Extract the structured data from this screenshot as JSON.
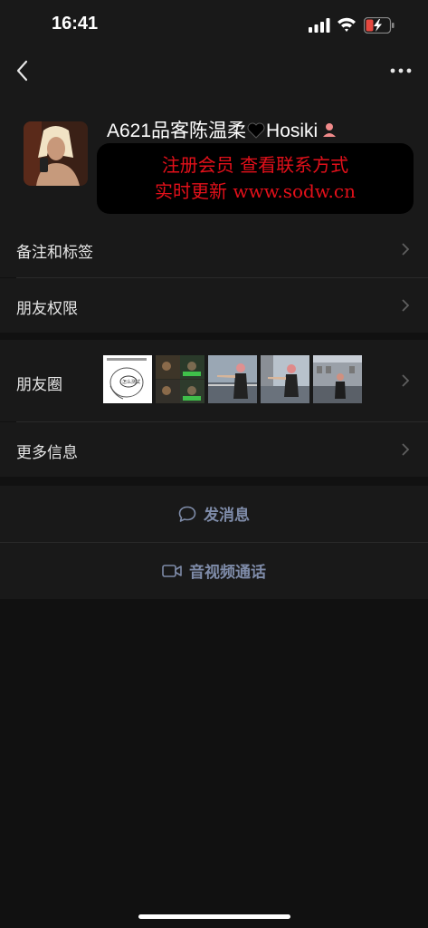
{
  "status_bar": {
    "time": "16:41"
  },
  "nav": {
    "back_icon": "chevron-left-icon",
    "more_icon": "ellipsis-icon"
  },
  "profile": {
    "nickname_prefix": "A621品客陈温柔",
    "nickname_suffix": "Hosiki",
    "promo_line1": "注册会员 查看联系方式",
    "promo_line2": "实时更新 www.sodw.cn",
    "promo_color": "#e2101a"
  },
  "rows": {
    "remarks_tags": "备注和标签",
    "friend_permissions": "朋友权限",
    "moments": "朋友圈",
    "more_info": "更多信息"
  },
  "moments_thumbnails": [
    {
      "name": "moment-thumb-sketch",
      "caption": "怎么测试"
    },
    {
      "name": "moment-thumb-meme"
    },
    {
      "name": "moment-thumb-photo-1"
    },
    {
      "name": "moment-thumb-photo-2"
    },
    {
      "name": "moment-thumb-photo-3"
    }
  ],
  "actions": {
    "send_message": "发消息",
    "video_call": "音视频通话"
  },
  "colors": {
    "background": "#111111",
    "surface": "#191919",
    "action_text": "#7e8ba8"
  }
}
